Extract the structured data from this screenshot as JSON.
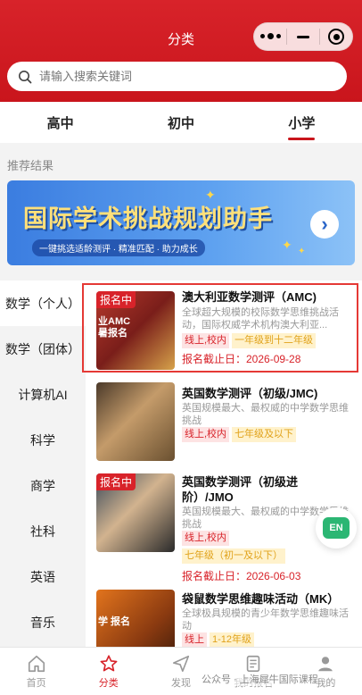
{
  "header": {
    "title": "分类"
  },
  "search": {
    "placeholder": "请输入搜索关键词"
  },
  "tabs": [
    {
      "label": "高中",
      "active": false
    },
    {
      "label": "初中",
      "active": false
    },
    {
      "label": "小学",
      "active": true
    }
  ],
  "recommend_label": "推荐结果",
  "banner": {
    "title": "国际学术挑战规划助手",
    "subtitle": "一键挑选适龄测评 · 精准匹配 · 助力成长"
  },
  "sidebar": {
    "items": [
      "数学（个人）",
      "数学（团体）",
      "计算机AI",
      "科学",
      "商学",
      "社科",
      "英语",
      "音乐"
    ],
    "active_index": 0
  },
  "cards": [
    {
      "badge": "报名中",
      "thumb_text": "业AMC\n暑报名",
      "title": "澳大利亚数学测评（AMC)",
      "desc": "全球超大规模的校际数学思维挑战活动，国际权威学术机构澳大利亚...",
      "tags": [
        "线上,校内",
        "一年级到十二年级"
      ],
      "deadline": "报名截止日：2026-09-28"
    },
    {
      "badge": "",
      "title": "英国数学测评（初级/JMC)",
      "desc": "英国规模最大、最权威的中学数学思维挑战",
      "tags": [
        "线上,校内",
        "七年级及以下"
      ],
      "deadline": ""
    },
    {
      "badge": "报名中",
      "title": "英国数学测评（初级进阶）/JMO",
      "desc": "英国规模最大、最权威的中学数学思维挑战",
      "tags": [
        "线上,校内",
        "七年级（初一及以下）"
      ],
      "deadline": "报名截止日：2026-06-03"
    },
    {
      "badge": "",
      "thumb_text": "学\n报名",
      "title": "袋鼠数学思维趣味活动（MK）",
      "desc": "全球极具规模的青少年数学思维趣味活动",
      "tags": [
        "线上",
        "1-12年级"
      ],
      "deadline": ""
    }
  ],
  "en_button": "EN",
  "bottom_nav": [
    {
      "label": "首页",
      "icon": "home-icon",
      "active": false
    },
    {
      "label": "分类",
      "icon": "star-icon",
      "active": true
    },
    {
      "label": "发现",
      "icon": "send-icon",
      "active": false
    },
    {
      "label": "我的报名",
      "icon": "list-icon",
      "active": false
    },
    {
      "label": "我的",
      "icon": "user-icon",
      "active": false
    }
  ],
  "watermark": "公众号 · 上海犀牛国际课程",
  "colors": {
    "brand": "#d8232a",
    "highlight": "#e53935",
    "tag_pink": "#fde3e3",
    "tag_yellow": "#fff2cc"
  }
}
